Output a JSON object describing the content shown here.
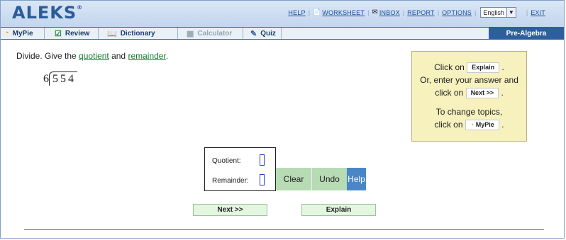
{
  "app": {
    "logo": "ALEKS",
    "logo_mark": "®"
  },
  "toplinks": {
    "help": "HELP",
    "worksheet": "WORKSHEET",
    "inbox": "INBOX",
    "report": "REPORT",
    "options": "OPTIONS",
    "language": "English",
    "exit": "EXIT"
  },
  "tabs": {
    "mypie": "MyPie",
    "review": "Review",
    "dictionary": "Dictionary",
    "calculator": "Calculator",
    "quiz": "Quiz",
    "course": "Pre-Algebra"
  },
  "question": {
    "prefix": "Divide. Give the ",
    "quotient_link": "quotient",
    "and": " and ",
    "remainder_link": "remainder",
    "suffix": ".",
    "divisor": "6",
    "dividend": "554"
  },
  "hint": {
    "line1_pre": "Click on",
    "explain_btn": "Explain",
    "line2": "Or, enter your answer and",
    "line3_pre": "click on",
    "next_btn": "Next >>",
    "line4": "To change topics,",
    "line5_pre": "click on",
    "mypie_btn": "MyPie",
    "period": "."
  },
  "answer": {
    "quotient_label": "Quotient:",
    "remainder_label": "Remainder:",
    "clear": "Clear",
    "undo": "Undo",
    "help": "Help"
  },
  "buttons": {
    "next": "Next >>",
    "explain": "Explain"
  },
  "colors": {
    "brand": "#2d5f9f",
    "link_green": "#1a7a2e",
    "hint_bg": "#f6f1bd",
    "action_green": "#b7dbb3",
    "help_blue": "#4a86c7"
  }
}
